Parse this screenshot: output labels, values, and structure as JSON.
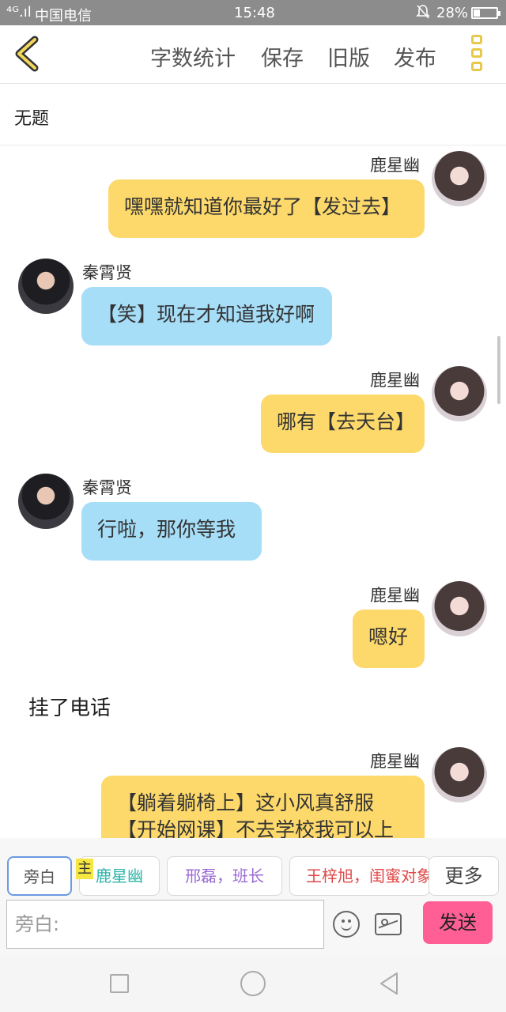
{
  "status_bar": {
    "signal": "⁴ᴳ.ıl",
    "carrier": "中国电信",
    "time": "15:48",
    "battery": "28%"
  },
  "toolbar": {
    "actions": [
      "字数统计",
      "保存",
      "旧版",
      "发布"
    ]
  },
  "document": {
    "title": "无题"
  },
  "chat": {
    "messages": [
      {
        "speaker": "鹿星幽",
        "text": "嘿嘿就知道你最好了【发过去】"
      },
      {
        "speaker": "秦霄贤",
        "text": "【笑】现在才知道我好啊"
      },
      {
        "speaker": "鹿星幽",
        "text": "哪有【去天台】"
      },
      {
        "speaker": "秦霄贤",
        "text": "行啦，那你等我"
      },
      {
        "speaker": "鹿星幽",
        "text": "嗯好"
      },
      {
        "narration": "挂了电话"
      },
      {
        "speaker": "鹿星幽",
        "text": "【躺着躺椅上】这小风真舒服\n【开始网课】不去学校我可以上"
      }
    ]
  },
  "role_bar": {
    "roles": [
      "旁白",
      "鹿星幽",
      "邢磊，班长",
      "王梓旭，闺蜜对象",
      "更多"
    ],
    "host_tag": "主",
    "role_colors": [
      "#555555",
      "#2bb5a8",
      "#9b6ad6",
      "#e04848",
      "#444444"
    ],
    "input_placeholder": "旁白:",
    "send_label": "发送"
  },
  "colors": {
    "my_bubble": "#fdd96b",
    "other_bubble": "#a6ddf7",
    "send_button": "#ff5f95",
    "accent_icon": "#e8c84a"
  }
}
